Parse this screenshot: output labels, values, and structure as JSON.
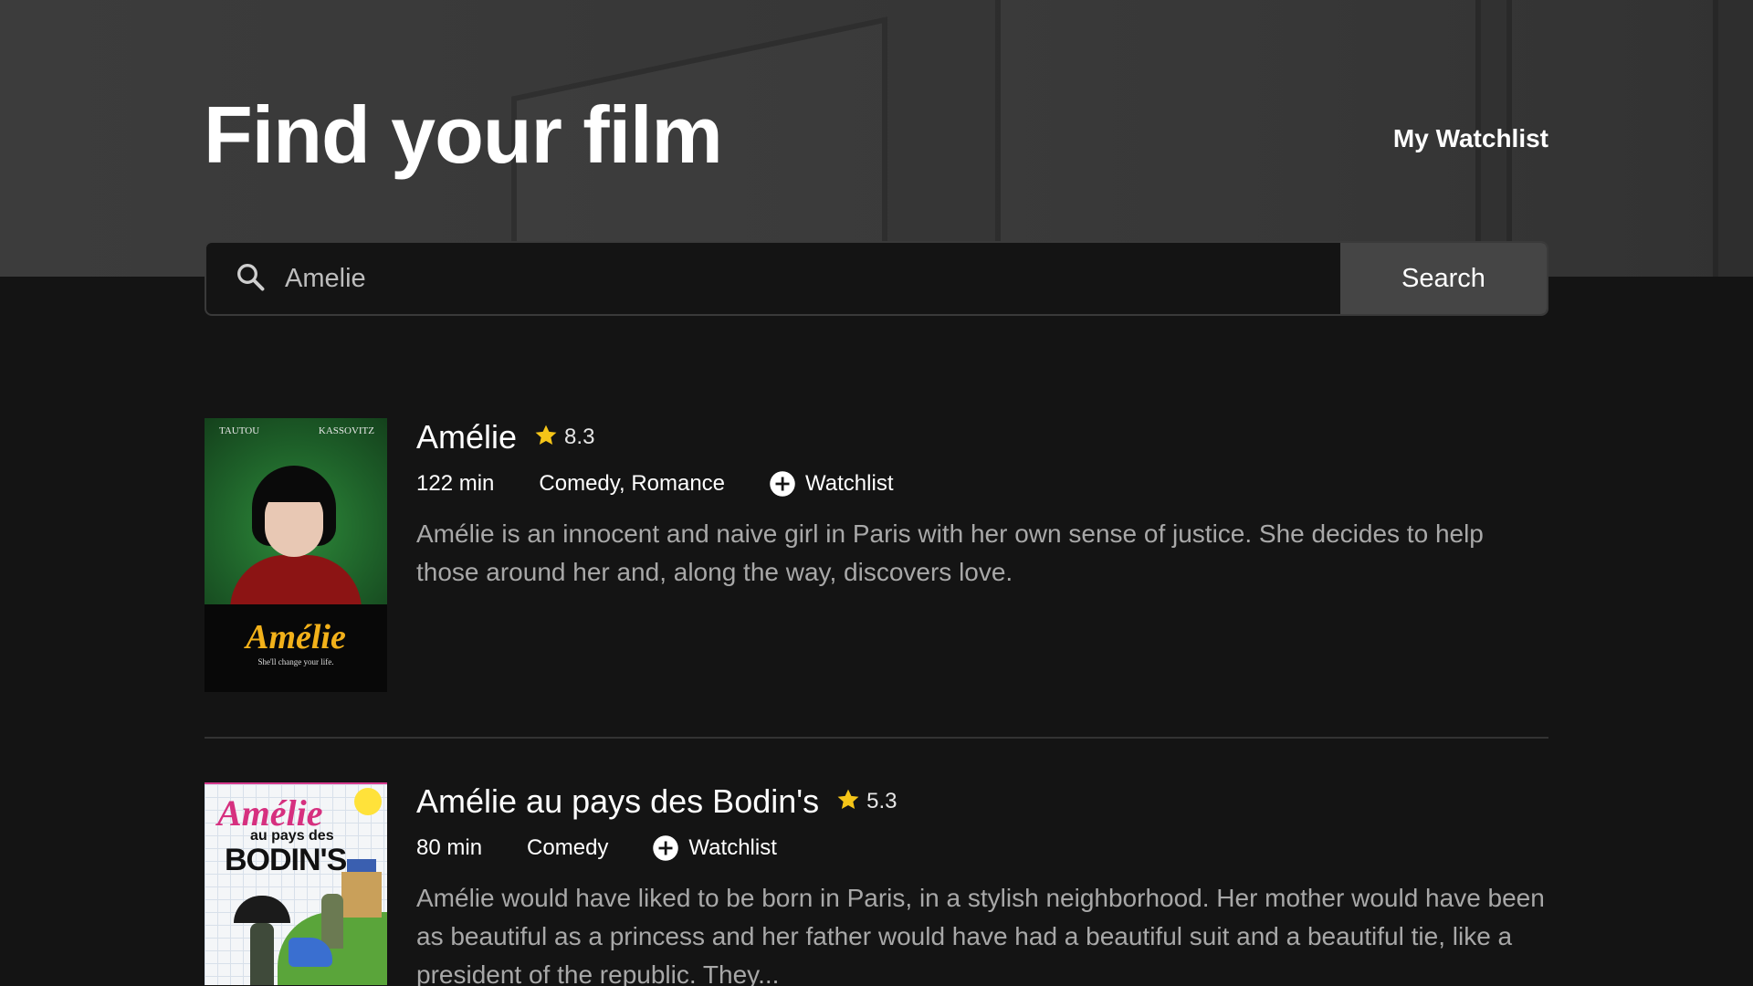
{
  "header": {
    "title": "Find your film",
    "watchlist_link": "My Watchlist"
  },
  "search": {
    "value": "Amelie",
    "button_label": "Search",
    "icon": "search-icon"
  },
  "results": [
    {
      "title": "Amélie",
      "rating": "8.3",
      "runtime": "122 min",
      "genres": "Comedy, Romance",
      "watchlist_label": "Watchlist",
      "description": "Amélie is an innocent and naive girl in Paris with her own sense of justice. She decides to help those around her and, along the way, discovers love.",
      "poster": {
        "actor_left": "TAUTOU",
        "actor_right": "KASSOVITZ",
        "logo": "Amélie",
        "tagline": "She'll change your life."
      }
    },
    {
      "title": "Amélie au pays des Bodin's",
      "rating": "5.3",
      "runtime": "80 min",
      "genres": "Comedy",
      "watchlist_label": "Watchlist",
      "description": "Amélie would have liked to be born in Paris, in a stylish neighborhood. Her mother would have been as beautiful as a princess and her father would have had a beautiful suit and a beautiful tie, like a president of the republic. They...",
      "poster": {
        "logo": "Amélie",
        "subtitle": "au pays des",
        "name": "BODIN'S"
      }
    }
  ],
  "colors": {
    "background": "#141414",
    "hero": "#3a3a3a",
    "star": "#f5c518",
    "description": "#a8a8a8",
    "search_button": "#454545"
  }
}
